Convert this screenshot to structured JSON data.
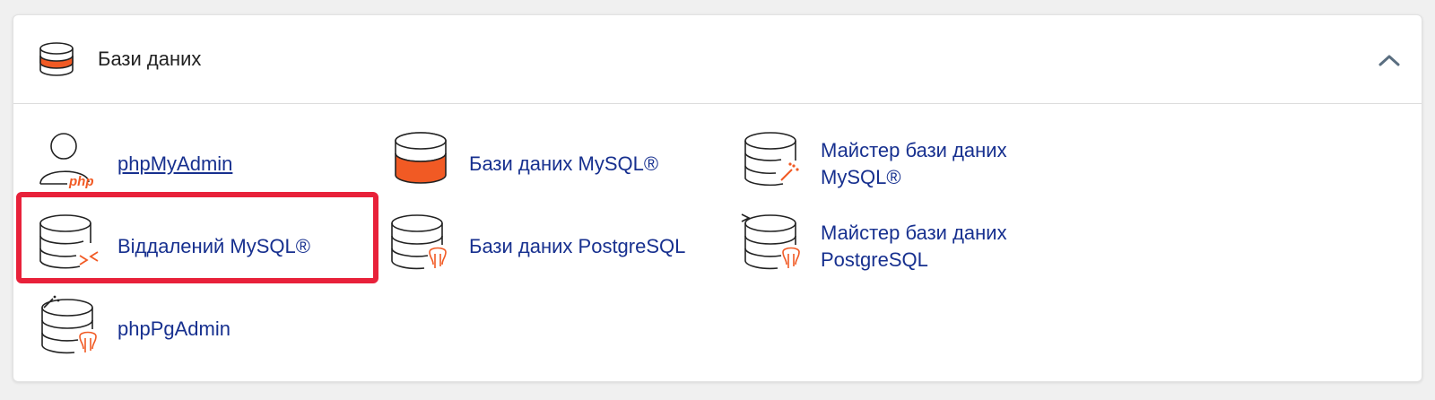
{
  "section": {
    "title": "Бази даних",
    "header_icon": "database-icon",
    "collapse_icon": "chevron-up-icon"
  },
  "items": [
    {
      "label": "phpMyAdmin",
      "icon": "phpmyadmin-icon"
    },
    {
      "label": "Бази даних MySQL®",
      "icon": "mysql-databases-icon"
    },
    {
      "label": "Майстер бази даних MySQL®",
      "icon": "mysql-database-wizard-icon"
    },
    {
      "label": "Віддалений MySQL®",
      "icon": "remote-mysql-icon",
      "highlighted": true
    },
    {
      "label": "Бази даних PostgreSQL",
      "icon": "postgresql-databases-icon"
    },
    {
      "label": "Майстер бази даних PostgreSQL",
      "icon": "postgresql-database-wizard-icon"
    },
    {
      "label": "phpPgAdmin",
      "icon": "phppgadmin-icon"
    }
  ],
  "colors": {
    "accent": "#f15a24",
    "link": "#17308f",
    "highlight": "#e8213a"
  }
}
